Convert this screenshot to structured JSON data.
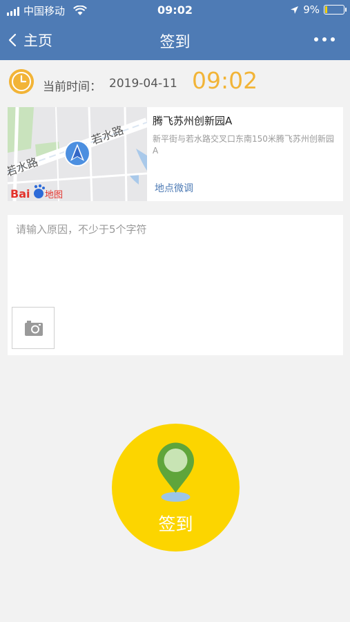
{
  "status_bar": {
    "carrier": "中国移动",
    "time": "09:02",
    "battery": "9%",
    "battery_level": 0.09
  },
  "nav": {
    "back_label": "主页",
    "title": "签到"
  },
  "time_row": {
    "label": "当前时间：",
    "date": "2019-04-11",
    "clock": "09:02"
  },
  "map": {
    "road_name_1": "若水路",
    "road_name_2": "若水路",
    "logo_text": "Bai",
    "logo_suffix": "地图"
  },
  "location": {
    "name": "腾飞苏州创新园A",
    "address": "新平街与若水路交叉口东南150米腾飞苏州创新园A",
    "adjust_label": "地点微调"
  },
  "reason": {
    "placeholder": "请输入原因，不少于5个字符",
    "value": ""
  },
  "checkin": {
    "label": "签到"
  },
  "colors": {
    "brand": "#4e7bb5",
    "accent_orange": "#f2b437",
    "checkin_yellow": "#fcd500",
    "pin_green": "#5fa53b"
  },
  "icons": {
    "signal": "signal-icon",
    "wifi": "wifi-icon",
    "location_arrow": "location-arrow-icon",
    "battery": "battery-icon",
    "back": "chevron-left-icon",
    "more": "more-dots-icon",
    "clock": "clock-icon",
    "navigation": "navigation-arrow-icon",
    "camera": "camera-icon",
    "pin": "map-pin-icon"
  }
}
